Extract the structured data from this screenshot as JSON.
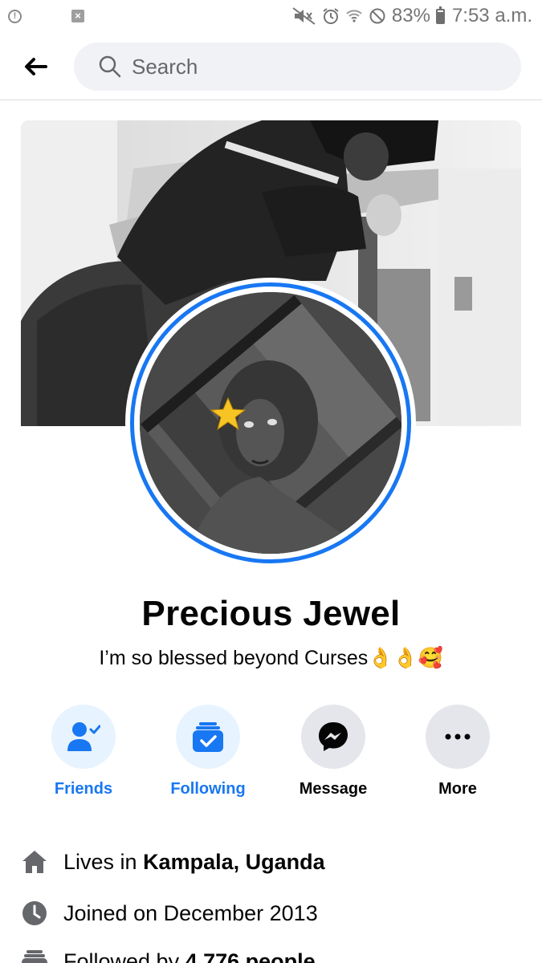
{
  "status_bar": {
    "battery": "83%",
    "time": "7:53 a.m.",
    "notification_x": "×",
    "notification_info": "!"
  },
  "search": {
    "placeholder": "Search"
  },
  "profile": {
    "name": "Precious Jewel",
    "bio": "I’m so blessed beyond Curses👌👌🥰"
  },
  "actions": [
    {
      "label": "Friends",
      "icon": "friends-check-icon",
      "style": "active"
    },
    {
      "label": "Following",
      "icon": "following-check-icon",
      "style": "active"
    },
    {
      "label": "Message",
      "icon": "messenger-icon",
      "style": "default"
    },
    {
      "label": "More",
      "icon": "more-dots-icon",
      "style": "default"
    }
  ],
  "details": {
    "lives": {
      "prefix": "Lives in ",
      "value": "Kampala, Uganda",
      "icon": "home-icon"
    },
    "joined": {
      "text": "Joined on December 2013",
      "icon": "clock-icon"
    },
    "followed": {
      "prefix": "Followed by ",
      "value": "4,776 people",
      "icon": "followers-icon"
    }
  },
  "colors": {
    "accent": "#1877f2",
    "accent_light": "#e7f3ff",
    "button_grey": "#e4e6eb",
    "search_bg": "#f0f2f5"
  }
}
